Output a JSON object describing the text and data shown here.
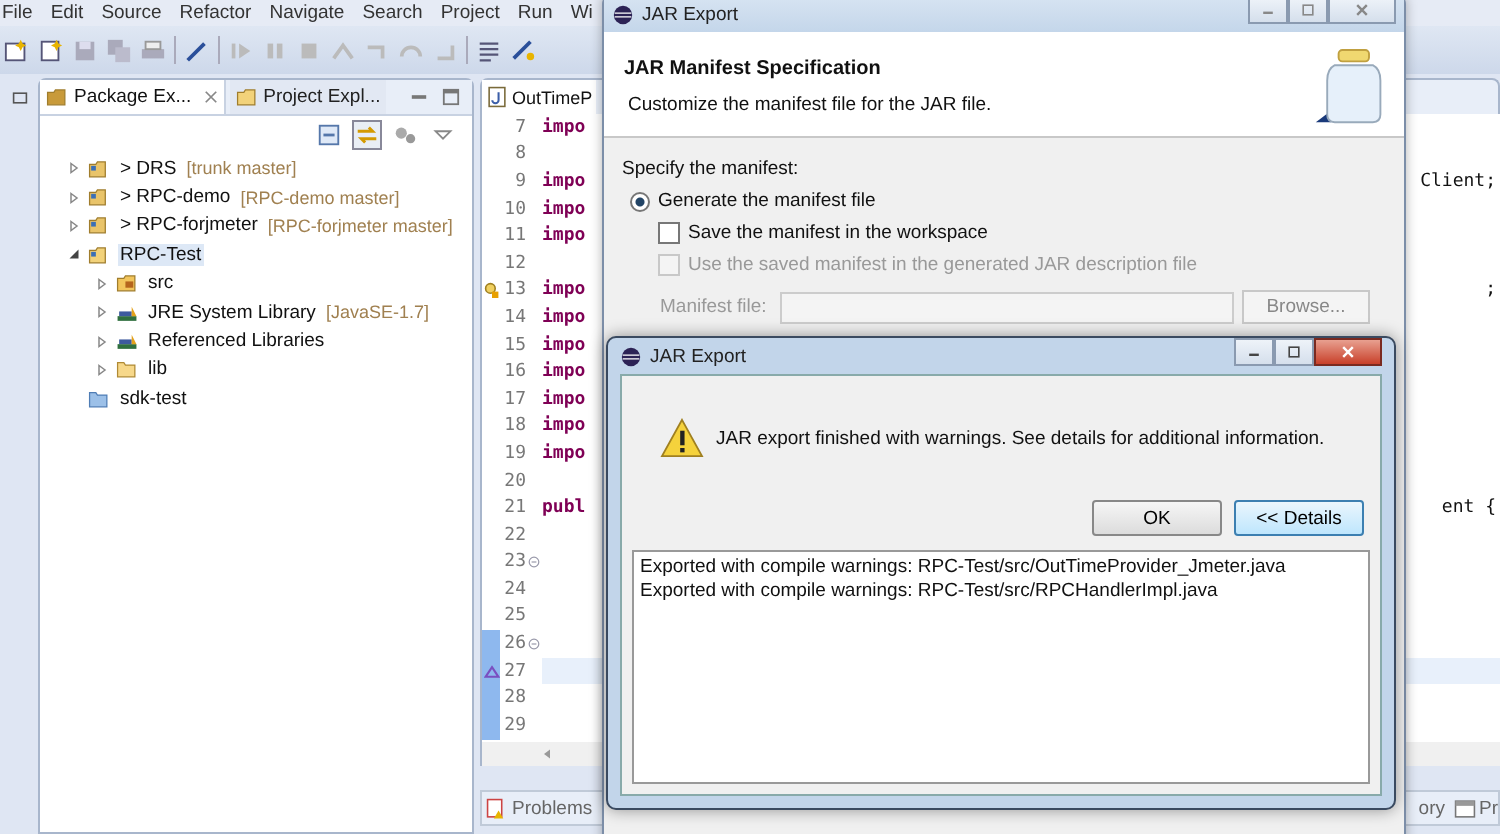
{
  "menu_bar": [
    "File",
    "Edit",
    "Source",
    "Refactor",
    "Navigate",
    "Search",
    "Project",
    "Run",
    "Wi"
  ],
  "package_explorer": {
    "tabs": [
      {
        "label": "Package Ex...",
        "selected": true
      },
      {
        "label": "Project Expl...",
        "selected": false
      }
    ],
    "tree": [
      {
        "kind": "git_project",
        "label": "> DRS",
        "decoration": "[trunk master]",
        "expanded": false,
        "selected": false
      },
      {
        "kind": "git_project",
        "label": "> RPC-demo",
        "decoration": "[RPC-demo master]",
        "expanded": false,
        "selected": false
      },
      {
        "kind": "git_project",
        "label": "> RPC-forjmeter",
        "decoration": "[RPC-forjmeter master]",
        "expanded": false,
        "selected": false
      },
      {
        "kind": "java_project",
        "label": "RPC-Test",
        "expanded": true,
        "selected": true,
        "children": [
          {
            "kind": "source_folder",
            "label": "src",
            "expanded": false,
            "selected": false
          },
          {
            "kind": "library",
            "label": "JRE System Library",
            "decoration": "[JavaSE-1.7]",
            "expanded": false,
            "selected": false
          },
          {
            "kind": "library",
            "label": "Referenced Libraries",
            "expanded": false,
            "selected": false
          },
          {
            "kind": "folder",
            "label": "lib",
            "expanded": false,
            "selected": false
          }
        ]
      },
      {
        "kind": "closed_project",
        "label": "sdk-test",
        "selected": false
      }
    ]
  },
  "editor": {
    "tab": "OutTimeP",
    "lines": [
      {
        "number": "7",
        "left": "impo"
      },
      {
        "number": "8"
      },
      {
        "number": "9",
        "left": "impo",
        "right": "Client;"
      },
      {
        "number": "10",
        "left": "impo"
      },
      {
        "number": "11",
        "left": "impo"
      },
      {
        "number": "12"
      },
      {
        "number": "13",
        "left": "impo",
        "right": ";",
        "warning": true
      },
      {
        "number": "14",
        "left": "impo"
      },
      {
        "number": "15",
        "left": "impo"
      },
      {
        "number": "16",
        "left": "impo"
      },
      {
        "number": "17",
        "left": "impo"
      },
      {
        "number": "18",
        "left": "impo"
      },
      {
        "number": "19",
        "left": "impo"
      },
      {
        "number": "20"
      },
      {
        "number": "21",
        "left": "publ",
        "right": "ent {"
      },
      {
        "number": "22"
      },
      {
        "number": "23",
        "fold": true
      },
      {
        "number": "24"
      },
      {
        "number": "25"
      },
      {
        "number": "26",
        "fold": true,
        "range": true
      },
      {
        "number": "27",
        "current": true,
        "range": true,
        "bookmark": true
      },
      {
        "number": "28",
        "range": true
      },
      {
        "number": "29",
        "range": true
      }
    ]
  },
  "bottom_tabs": [
    {
      "label": "Problems",
      "kind": "problems"
    },
    {
      "label": "ory",
      "kind": "plain"
    },
    {
      "label": "Pr",
      "kind": "progress"
    }
  ],
  "manifest_dialog": {
    "title": "JAR Export",
    "heading": "JAR Manifest Specification",
    "description": "Customize the manifest file for the JAR file.",
    "section_label": "Specify the manifest:",
    "options": [
      {
        "kind": "radio",
        "label": "Generate the manifest file",
        "selected": true,
        "disabled": false
      },
      {
        "kind": "checkbox",
        "label": "Save the manifest in the workspace",
        "checked": false,
        "disabled": false
      },
      {
        "kind": "checkbox",
        "label": "Use the saved manifest in the generated JAR description file",
        "checked": false,
        "disabled": true
      }
    ],
    "manifest_field": {
      "label": "Manifest file:",
      "disabled": true
    },
    "browse_button": "Browse..."
  },
  "export_dialog": {
    "title": "JAR Export",
    "message": "JAR export finished with warnings. See details for additional information.",
    "buttons": [
      {
        "label": "OK",
        "focused": false
      },
      {
        "label": "<< Details",
        "focused": true
      }
    ],
    "details": [
      "Exported with compile warnings: RPC-Test/src/OutTimeProvider_Jmeter.java",
      "Exported with compile warnings: RPC-Test/src/RPCHandlerImpl.java"
    ]
  }
}
